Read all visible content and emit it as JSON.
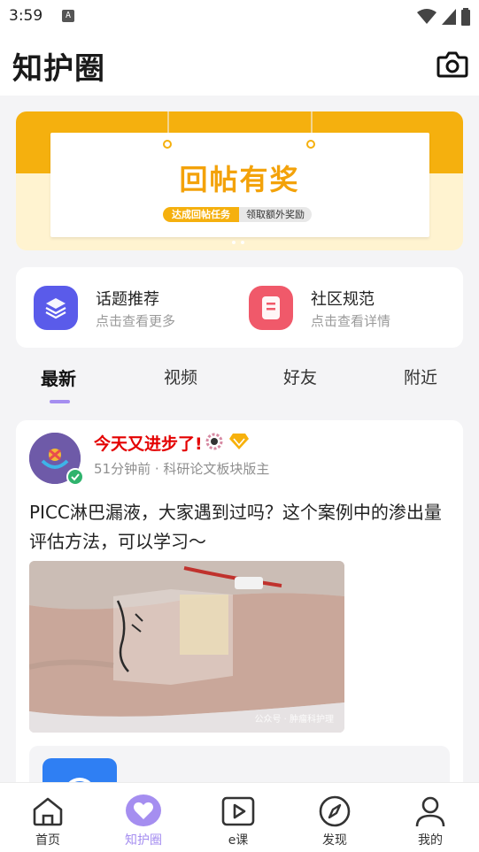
{
  "status_bar": {
    "time": "3:59",
    "notification_icon": "A"
  },
  "header": {
    "title": "知护圈",
    "camera_icon": "camera-icon"
  },
  "banner": {
    "headline": "回帖有奖",
    "badge_left": "达成回帖任务",
    "badge_right": "领取额外奖励",
    "accent_color": "#f5b00e"
  },
  "shortcuts": [
    {
      "title": "话题推荐",
      "subtitle": "点击查看更多",
      "icon": "topics-icon",
      "color": "#5a5bea"
    },
    {
      "title": "社区规范",
      "subtitle": "点击查看详情",
      "icon": "rules-icon",
      "color": "#f0596a"
    }
  ],
  "tabs": [
    {
      "label": "最新",
      "active": true
    },
    {
      "label": "视频",
      "active": false
    },
    {
      "label": "好友",
      "active": false
    },
    {
      "label": "附近",
      "active": false
    }
  ],
  "post": {
    "username": "今天又进步了!",
    "meta": "51分钟前 · 科研论文板块版主",
    "content": "PICC淋巴漏液，大家遇到过吗？这个案例中的渗出量评估方法，可以学习～",
    "image_watermark": "公众号 · 肿瘤科护理"
  },
  "bottom_nav": [
    {
      "label": "首页",
      "icon": "home-icon",
      "active": false
    },
    {
      "label": "知护圈",
      "icon": "heart-chat-icon",
      "active": true
    },
    {
      "label": "e课",
      "icon": "play-icon",
      "active": false
    },
    {
      "label": "发现",
      "icon": "compass-icon",
      "active": false
    },
    {
      "label": "我的",
      "icon": "profile-icon",
      "active": false
    }
  ]
}
